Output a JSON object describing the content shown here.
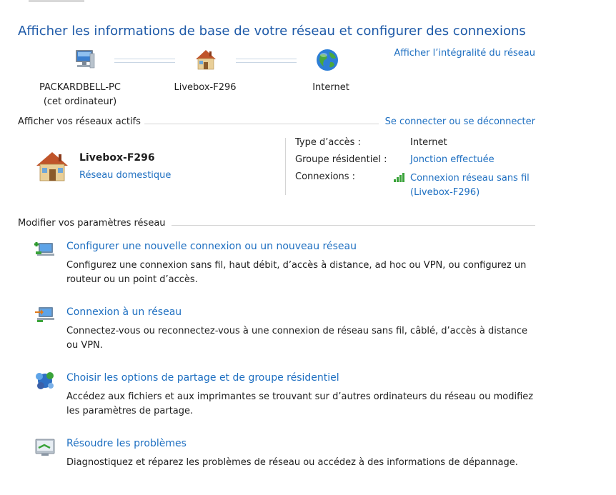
{
  "header": {
    "title": "Afficher les informations de base de votre réseau et configurer des connexions",
    "full_map_link": "Afficher l’intégralité du réseau"
  },
  "network_map": {
    "computer_name": "PACKARDBELL-PC",
    "computer_sub": "(cet ordinateur)",
    "router_name": "Livebox-F296",
    "internet_label": "Internet"
  },
  "active_networks": {
    "heading": "Afficher vos réseaux actifs",
    "connect_link": "Se connecter ou se déconnecter",
    "network_name": "Livebox-F296",
    "network_type": "Réseau domestique",
    "access_type_label": "Type d’accès :",
    "access_type_value": "Internet",
    "homegroup_label": "Groupe résidentiel :",
    "homegroup_value": "Jonction effectuée",
    "connections_label": "Connexions :",
    "connection_line1": "Connexion réseau sans fil",
    "connection_line2": "(Livebox-F296)"
  },
  "settings": {
    "heading": "Modifier vos paramètres réseau",
    "tasks": [
      {
        "title": "Configurer une nouvelle connexion ou un nouveau réseau",
        "line1": "Configurez une connexion sans fil, haut débit, d’accès à distance, ad hoc ou VPN, ou configurez un",
        "line2": "routeur ou un point d’accès."
      },
      {
        "title": "Connexion à un réseau",
        "line1": "Connectez-vous ou reconnectez-vous à une connexion de réseau sans fil, câblé, d’accès à distance",
        "line2": "ou VPN."
      },
      {
        "title": "Choisir les options de partage et de groupe résidentiel",
        "line1": "Accédez aux fichiers et aux imprimantes se trouvant sur d’autres ordinateurs du réseau ou modifiez",
        "line2": "les paramètres de partage."
      },
      {
        "title": "Résoudre les problèmes",
        "line1": "Diagnostiquez et réparez les problèmes de réseau ou accédez à des informations de dépannage."
      }
    ]
  },
  "icons": {
    "computer": "computer-icon",
    "house": "house-icon",
    "globe": "globe-icon",
    "signal": "wifi-signal-icon",
    "new_connection": "new-connection-icon",
    "connect": "connect-network-icon",
    "sharing": "homegroup-sharing-icon",
    "troubleshoot": "troubleshoot-icon"
  },
  "colors": {
    "link": "#1e6fc1",
    "title": "#1e5aa8",
    "signal": "#3aa33a"
  }
}
